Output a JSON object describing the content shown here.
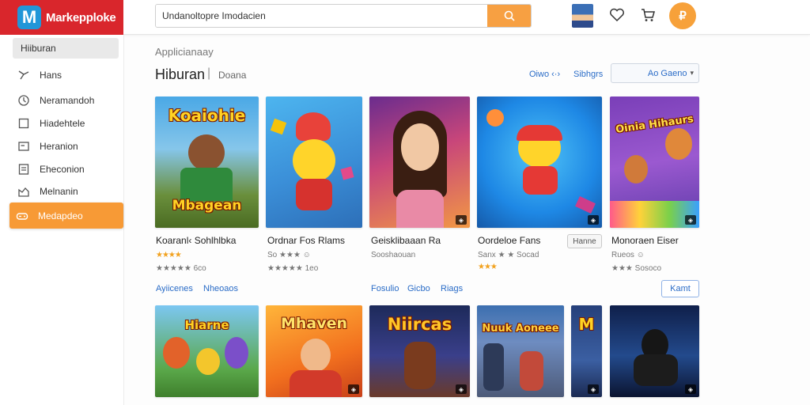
{
  "header": {
    "brand_logo_letter": "M",
    "brand_name": "Markepploke",
    "search_value": "Undanoltopre Imodacien",
    "coin_label": "₽"
  },
  "sidebar": {
    "items": [
      {
        "label": "Hiiburan",
        "icon": "none"
      },
      {
        "label": "Hans",
        "icon": "sparkle-icon"
      },
      {
        "label": "Neramandoh",
        "icon": "clock-icon"
      },
      {
        "label": "Hiadehtele",
        "icon": "square-icon"
      },
      {
        "label": "Heranion",
        "icon": "card-icon"
      },
      {
        "label": "Eheconion",
        "icon": "list-icon"
      },
      {
        "label": "Melnanin",
        "icon": "chart-icon"
      },
      {
        "label": "Medapdeo",
        "icon": "gamepad-icon"
      }
    ]
  },
  "main": {
    "breadcrumb": "Applicianaay",
    "title": "Hiburan",
    "title_sep": "|",
    "title_sub": "Doana",
    "toolbar": {
      "link1": "Oiwo",
      "link1_arrows": "‹·›",
      "link2": "Sibhgrs",
      "sort_label": "Ao  Gaeno"
    },
    "row1": [
      {
        "title": "Koaranl‹ Sohlhlbka",
        "stars": "★★★★",
        "meta_top": "",
        "meta": "★★★★★ 6co",
        "art": "Koaiohie",
        "art_sub": "Mbagean"
      },
      {
        "title": "Ordnar Fos Rlams",
        "stars": "",
        "meta_top": "So ★★★ ☺",
        "meta": "★★★★★ 1eo",
        "art": "",
        "art_sub": ""
      },
      {
        "title": "Geisklibaaan Ra",
        "stars": "",
        "meta_top": "Sooshaouan",
        "meta": "",
        "art": "",
        "art_sub": ""
      },
      {
        "title": "Oordeloe Fans",
        "stars": "★★★",
        "meta_top": "Sanx ★ ★ Socad",
        "meta": "",
        "art": "",
        "art_sub": ""
      },
      {
        "title": "Monoraen Eiser",
        "stars": "",
        "meta_top": "Rueos ☺",
        "meta": "★★★ Sosoco",
        "art": "Oinia Hihaurs",
        "art_sub": ""
      }
    ],
    "row_links": {
      "a": "Ayiicenes",
      "b": "Nheoaos",
      "c": "Fosulio",
      "d": "Gicbo",
      "e": "Riags"
    },
    "hanne_btn": "Hanne",
    "kamt_btn": "Kamt",
    "row2": [
      {
        "art": "Hiarne"
      },
      {
        "art": "Mhaven"
      },
      {
        "art": "Niircas"
      },
      {
        "art": "Nuuk Aoneee"
      },
      {
        "art": "M"
      },
      {
        "art": ""
      }
    ]
  },
  "colors": {
    "brand": "#d9262c",
    "accent": "#f79a36",
    "link": "#2a6cc7"
  }
}
